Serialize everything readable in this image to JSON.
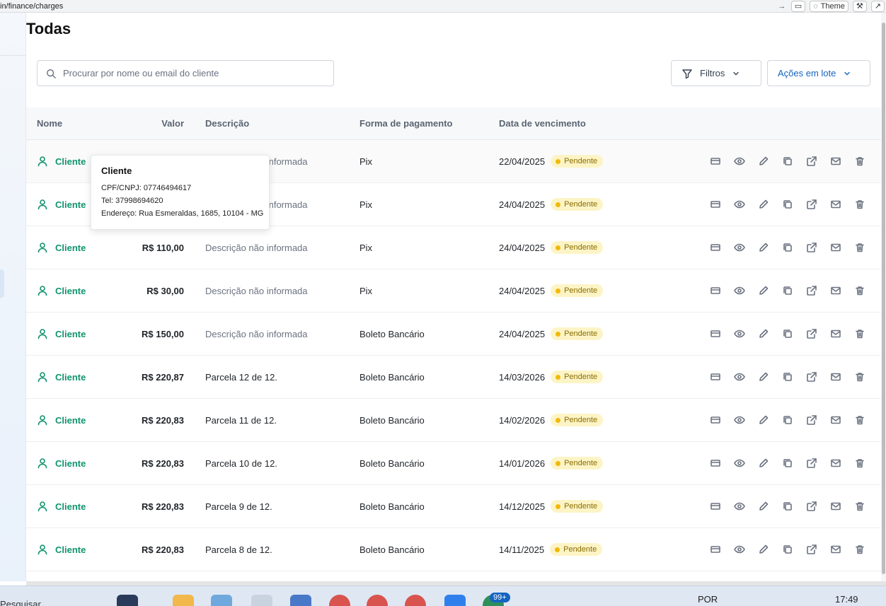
{
  "browser": {
    "url": "in/finance/charges",
    "theme_label": "Theme"
  },
  "page": {
    "title": "Todas"
  },
  "search": {
    "placeholder": "Procurar por nome ou email do cliente"
  },
  "toolbar": {
    "filter_label": "Filtros",
    "bulk_label": "Ações em lote"
  },
  "table": {
    "headers": {
      "nome": "Nome",
      "valor": "Valor",
      "descricao": "Descrição",
      "forma": "Forma de pagamento",
      "data": "Data de vencimento"
    },
    "rows": [
      {
        "cliente": "Cliente",
        "valor": "",
        "descricao": "Descrição não informada",
        "forma": "Pix",
        "data": "22/04/2025",
        "status": "Pendente"
      },
      {
        "cliente": "Cliente",
        "valor": "",
        "descricao": "Descrição não informada",
        "forma": "Pix",
        "data": "24/04/2025",
        "status": "Pendente"
      },
      {
        "cliente": "Cliente",
        "valor": "R$ 110,00",
        "descricao": "Descrição não informada",
        "forma": "Pix",
        "data": "24/04/2025",
        "status": "Pendente"
      },
      {
        "cliente": "Cliente",
        "valor": "R$ 30,00",
        "descricao": "Descrição não informada",
        "forma": "Pix",
        "data": "24/04/2025",
        "status": "Pendente"
      },
      {
        "cliente": "Cliente",
        "valor": "R$ 150,00",
        "descricao": "Descrição não informada",
        "forma": "Boleto Bancário",
        "data": "24/04/2025",
        "status": "Pendente"
      },
      {
        "cliente": "Cliente",
        "valor": "R$ 220,87",
        "descricao": "Parcela 12 de 12.",
        "forma": "Boleto Bancário",
        "data": "14/03/2026",
        "status": "Pendente"
      },
      {
        "cliente": "Cliente",
        "valor": "R$ 220,83",
        "descricao": "Parcela 11 de 12.",
        "forma": "Boleto Bancário",
        "data": "14/02/2026",
        "status": "Pendente"
      },
      {
        "cliente": "Cliente",
        "valor": "R$ 220,83",
        "descricao": "Parcela 10 de 12.",
        "forma": "Boleto Bancário",
        "data": "14/01/2026",
        "status": "Pendente"
      },
      {
        "cliente": "Cliente",
        "valor": "R$ 220,83",
        "descricao": "Parcela 9 de 12.",
        "forma": "Boleto Bancário",
        "data": "14/12/2025",
        "status": "Pendente"
      },
      {
        "cliente": "Cliente",
        "valor": "R$ 220,83",
        "descricao": "Parcela 8 de 12.",
        "forma": "Boleto Bancário",
        "data": "14/11/2025",
        "status": "Pendente"
      }
    ],
    "actions": [
      "card-icon",
      "eye-icon",
      "pencil-icon",
      "copy-icon",
      "external-link-icon",
      "mail-icon",
      "trash-icon"
    ]
  },
  "tooltip": {
    "title": "Cliente",
    "cpf": "CPF/CNPJ: 07746494617",
    "tel": "Tel: 37998694620",
    "endereco": "Endereço: Rua Esmeraldas, 1685, 10104 - MG"
  },
  "taskbar": {
    "search": "Pesquisar",
    "badge": "99+",
    "lang": "POR",
    "time": "17:49"
  },
  "colors": {
    "accent_green": "#12936e",
    "accent_blue": "#1565c0",
    "pending_bg": "#fdf4c6",
    "pending_dot": "#f0b90b"
  }
}
